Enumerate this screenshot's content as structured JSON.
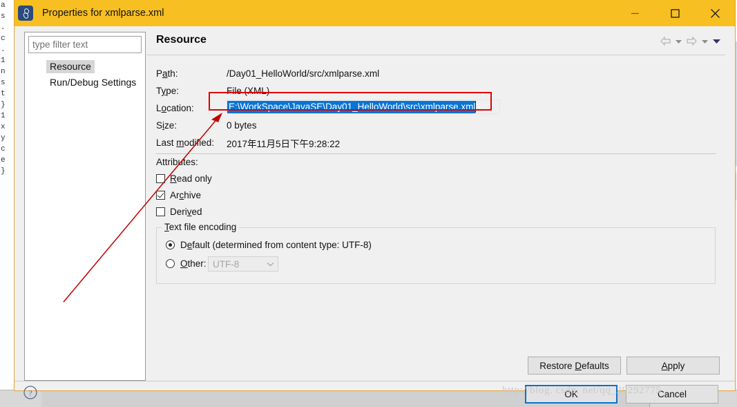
{
  "window": {
    "title": "Properties for xmlparse.xml",
    "icon": "eclipse-icon",
    "accent_color": "#f7bf21",
    "minimize_label": "Minimize",
    "maximize_label": "Maximize",
    "close_label": "Close"
  },
  "sidebar": {
    "filter": {
      "placeholder": "type filter text",
      "value": ""
    },
    "items": [
      {
        "label": "Resource",
        "selected": true
      },
      {
        "label": "Run/Debug Settings",
        "selected": false
      }
    ]
  },
  "content": {
    "heading": "Resource",
    "nav": {
      "back_label": "Back",
      "back_menu_label": "Back history",
      "forward_label": "Forward",
      "forward_menu_label": "Forward history",
      "view_menu_label": "View menu"
    },
    "properties": [
      {
        "label_pre": "P",
        "label_mnemonic": "a",
        "label_post": "th:",
        "value": "/Day01_HelloWorld/src/xmlparse.xml"
      },
      {
        "label_pre": "T",
        "label_mnemonic": "y",
        "label_post": "pe:",
        "value": "File  (XML)"
      },
      {
        "label_pre": "L",
        "label_mnemonic": "o",
        "label_post": "cation:",
        "value": "E:\\WorkSpace\\JavaSE\\Day01_HelloWorld\\src\\xmlparse.xml"
      },
      {
        "label_pre": "S",
        "label_mnemonic": "i",
        "label_post": "ze:",
        "value": "0 bytes"
      },
      {
        "label_pre": "Last ",
        "label_mnemonic": "m",
        "label_post": "odified:",
        "value": "2017年11月5日下午9:28:22"
      }
    ],
    "location_selected": true,
    "attributes": {
      "label": "Attributes:",
      "items": [
        {
          "pre": "",
          "mnemonic": "R",
          "post": "ead only",
          "checked": false
        },
        {
          "pre": "Ar",
          "mnemonic": "c",
          "post": "hive",
          "checked": true
        },
        {
          "pre": "Deri",
          "mnemonic": "v",
          "post": "ed",
          "checked": false
        }
      ]
    },
    "encoding": {
      "legend_pre": "",
      "legend_mnemonic": "T",
      "legend_post": "ext file encoding",
      "default_option": {
        "pre": "D",
        "mnemonic": "e",
        "post": "fault (determined from content type: UTF-8)",
        "selected": true
      },
      "other_option": {
        "pre": "",
        "mnemonic": "O",
        "post": "ther:",
        "selected": false,
        "combo_value": "UTF-8",
        "combo_enabled": false
      }
    },
    "buttons": {
      "restore_pre": "Restore ",
      "restore_mnemonic": "D",
      "restore_post": "efaults",
      "apply_pre": "",
      "apply_mnemonic": "A",
      "apply_post": "pply"
    }
  },
  "footer": {
    "help_label": "Help",
    "ok_label": "OK",
    "cancel_label": "Cancel"
  },
  "annotations": {
    "highlight_box_target": "location-field",
    "arrow_target": "size-value",
    "color": "#e10000"
  },
  "watermark": {
    "text": "http://blog. csdn. net/qq_29292775"
  },
  "background": {
    "editor_glyphs": [
      "a",
      "s",
      ".",
      "c",
      ".",
      "1",
      "n",
      "s",
      "t",
      "}",
      "1",
      "x",
      "y",
      "c",
      "e",
      "}"
    ]
  }
}
